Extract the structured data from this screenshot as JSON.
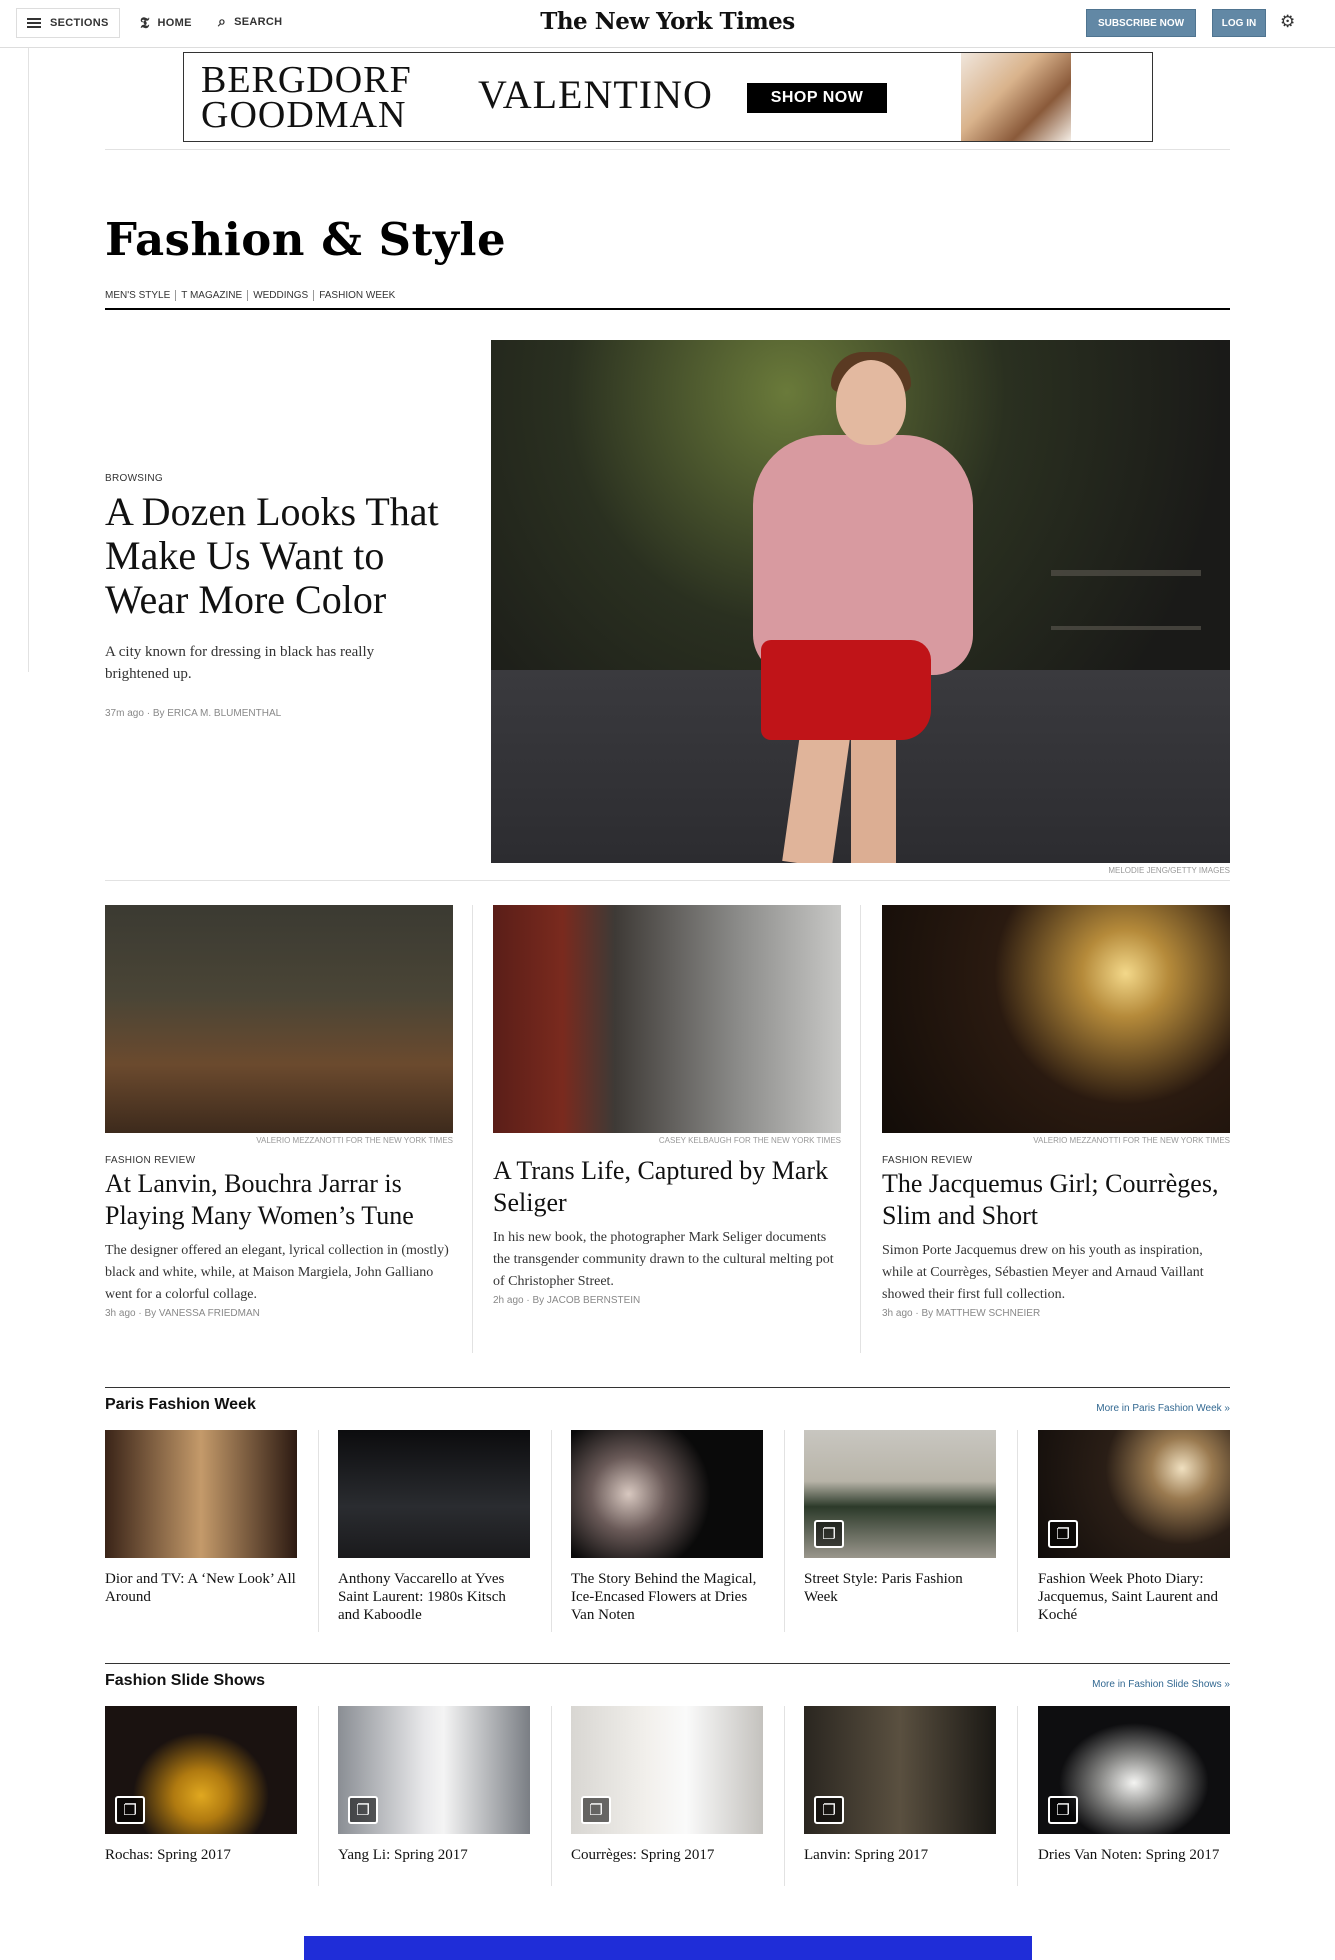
{
  "topbar": {
    "sections_label": "SECTIONS",
    "home_label": "HOME",
    "search_label": "SEARCH",
    "masthead": "The New York Times",
    "subscribe_label": "SUBSCRIBE NOW",
    "login_label": "LOG IN"
  },
  "ad": {
    "brand_line1": "BERGDORF",
    "brand_line2": "GOODMAN",
    "designer": "VALENTINO",
    "cta": "SHOP NOW"
  },
  "section": {
    "title": "Fashion & Style",
    "subnav": [
      "MEN'S STYLE",
      "T MAGAZINE",
      "WEDDINGS",
      "FASHION WEEK"
    ]
  },
  "lead": {
    "kicker": "BROWSING",
    "headline": "A Dozen Looks That Make Us Want to Wear More Color",
    "summary": "A city known for dressing in black has really brightened up.",
    "time": "37m ago",
    "author": "By ERICA M. BLUMENTHAL",
    "credit": "MELODIE JENG/GETTY IMAGES"
  },
  "stories": [
    {
      "credit": "VALERIO MEZZANOTTI FOR THE NEW YORK TIMES",
      "kicker": "FASHION REVIEW",
      "headline": "At Lanvin, Bouchra Jarrar is Playing Many Women’s Tune",
      "summary": "The designer offered an elegant, lyrical collection in (mostly) black and white, while, at Maison Margiela, John Galliano went for a colorful collage.",
      "time": "3h ago",
      "author": "By VANESSA FRIEDMAN"
    },
    {
      "credit": "CASEY KELBAUGH FOR THE NEW YORK TIMES",
      "kicker": "",
      "headline": "A Trans Life, Captured by Mark Seliger",
      "summary": "In his new book, the photographer Mark Seliger documents the transgender community drawn to the cultural melting pot of Christopher Street.",
      "time": "2h ago",
      "author": "By JACOB BERNSTEIN"
    },
    {
      "credit": "VALERIO MEZZANOTTI FOR THE NEW YORK TIMES",
      "kicker": "FASHION REVIEW",
      "headline": "The Jacquemus Girl; Courrèges, Slim and Short",
      "summary": "Simon Porte Jacquemus drew on his youth as inspiration, while at Courrèges, Sébastien Meyer and Arnaud Vaillant showed their first full collection.",
      "time": "3h ago",
      "author": "By MATTHEW SCHNEIER"
    }
  ],
  "paris": {
    "title": "Paris Fashion Week",
    "more": "More in Paris Fashion Week »",
    "items": [
      {
        "caption": "Dior and TV: A ‘New Look’ All Around",
        "slideshow": false
      },
      {
        "caption": "Anthony Vaccarello at Yves Saint Laurent: 1980s Kitsch and Kaboodle",
        "slideshow": false
      },
      {
        "caption": "The Story Behind the Magical, Ice-Encased Flowers at Dries Van Noten",
        "slideshow": false
      },
      {
        "caption": "Street Style: Paris Fashion Week",
        "slideshow": true
      },
      {
        "caption": "Fashion Week Photo Diary: Jacquemus, Saint Laurent and Koché",
        "slideshow": true
      }
    ]
  },
  "slides": {
    "title": "Fashion Slide Shows",
    "more": "More in Fashion Slide Shows »",
    "items": [
      {
        "caption": "Rochas: Spring 2017",
        "slideshow": true
      },
      {
        "caption": "Yang Li: Spring 2017",
        "slideshow": true
      },
      {
        "caption": "Courrèges: Spring 2017",
        "slideshow": true
      },
      {
        "caption": "Lanvin: Spring 2017",
        "slideshow": true
      },
      {
        "caption": "Dries Van Noten: Spring 2017",
        "slideshow": true
      }
    ]
  },
  "icons": {
    "menu": "hamburger-icon",
    "home": "nyt-t-icon",
    "search": "search-icon",
    "settings": "gear-icon",
    "slideshow": "slideshow-icon"
  },
  "colors": {
    "button_blue": "#6288a5",
    "link_blue": "#326891",
    "lead_skirt_red": "#c01418",
    "bottom_ad_blue": "#1f2dd8"
  }
}
